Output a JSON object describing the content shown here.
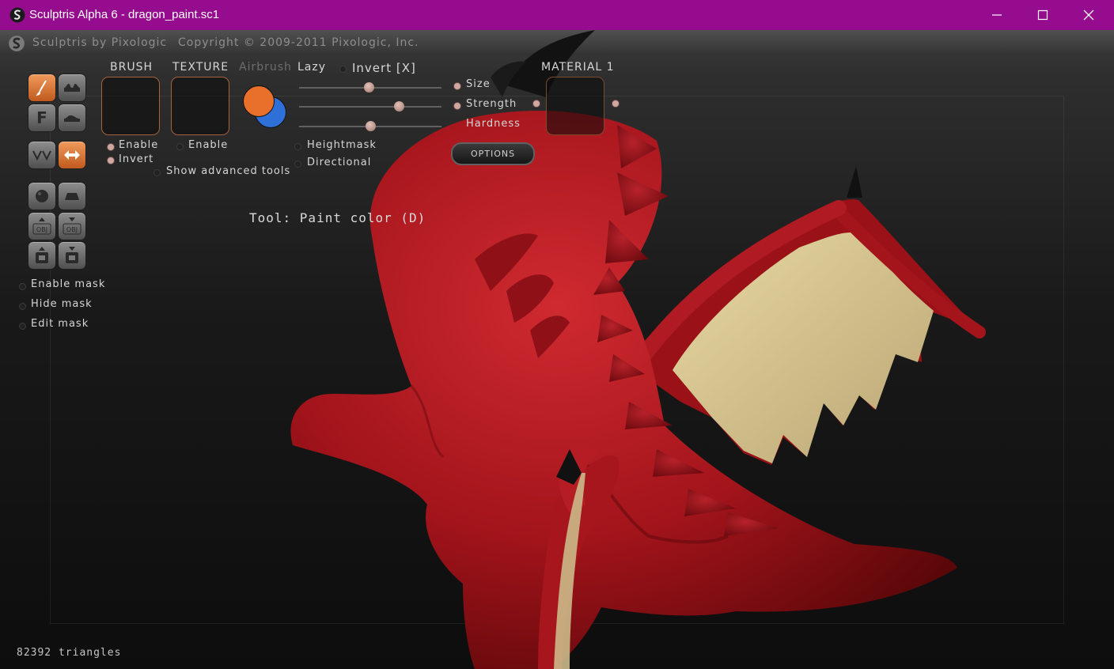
{
  "window": {
    "title": "Sculptris Alpha 6 - dragon_paint.sc1",
    "minimize_icon": "minimize-icon",
    "maximize_icon": "maximize-icon",
    "close_icon": "close-icon"
  },
  "header": {
    "brand": "Sculptris by Pixologic",
    "copyright": "Copyright © 2009-2011 Pixologic, Inc."
  },
  "toolbar": {
    "brush_label": "BRUSH",
    "texture_label": "TEXTURE",
    "airbrush_label": "Airbrush",
    "lazy_label": "Lazy",
    "invert_label": "Invert [X]",
    "material_label": "MATERIAL 1",
    "brush_enable_label": "Enable",
    "brush_invert_label": "Invert",
    "texture_enable_label": "Enable",
    "show_advanced_label": "Show advanced tools",
    "heightmask_label": "Heightmask",
    "directional_label": "Directional",
    "options_label": "OPTIONS",
    "primary_color": "#e8702a",
    "secondary_color": "#2f6fd8"
  },
  "sliders": {
    "size_label": "Size",
    "strength_label": "Strength",
    "hardness_label": "Hardness",
    "size_value": 0.49,
    "strength_value": 0.7,
    "hardness_value": 0.5
  },
  "tool_buttons": [
    "paint-brush-icon",
    "stamp-icon",
    "flatten-icon",
    "smooth-icon",
    "symmetry-icon",
    "move-icon",
    "sphere-icon",
    "plane-icon",
    "import-obj-icon",
    "export-obj-icon",
    "open-file-icon",
    "save-file-icon"
  ],
  "mask": {
    "enable_label": "Enable mask",
    "hide_label": "Hide mask",
    "edit_label": "Edit mask"
  },
  "tool_label": "Tool: Paint color (D)",
  "status": {
    "triangles": "82392 triangles"
  },
  "colors": {
    "titlebar": "#950c8e",
    "dragon_red": "#a8141c",
    "wing_membrane": "#d3c38e",
    "accent_orange": "#e8702a"
  }
}
